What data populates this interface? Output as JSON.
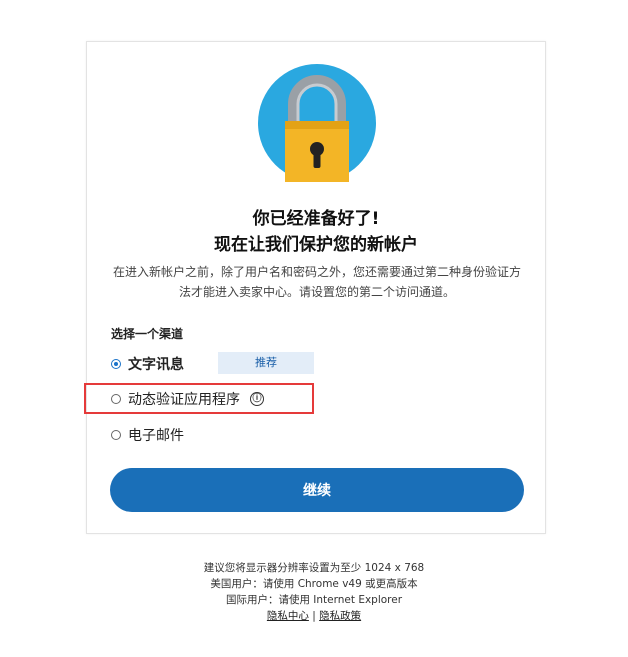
{
  "headline": [
    "你已经准备好了!",
    "现在让我们保护您的新帐户"
  ],
  "description": "在进入新帐户之前，除了用户名和密码之外，您还需要通过第二种身份验证方法才能进入卖家中心。请设置您的第二个访问通道。",
  "choose_label": "选择一个渠道",
  "options": [
    {
      "label": "文字讯息",
      "selected": true,
      "badge": "推荐"
    },
    {
      "label": "动态验证应用程序",
      "selected": false,
      "info_icon": "ⓘ"
    },
    {
      "label": "电子邮件",
      "selected": false
    }
  ],
  "continue_label": "继续",
  "footer": {
    "line1": "建议您将显示器分辨率设置为至少 1024 x 768",
    "line2": "美国用户：请使用 Chrome v49 或更高版本",
    "line3": "国际用户：请使用 Internet Explorer",
    "privacy_center": "隐私中心",
    "separator": " | ",
    "privacy_policy": "隐私政策"
  },
  "colors": {
    "accent": "#1a6fb8",
    "highlight_border": "#e53a3a",
    "badge_bg": "#e3edf8",
    "lock_circle": "#2aa8e0",
    "lock_body": "#f3b526",
    "lock_shackle": "#9aa0a6"
  }
}
